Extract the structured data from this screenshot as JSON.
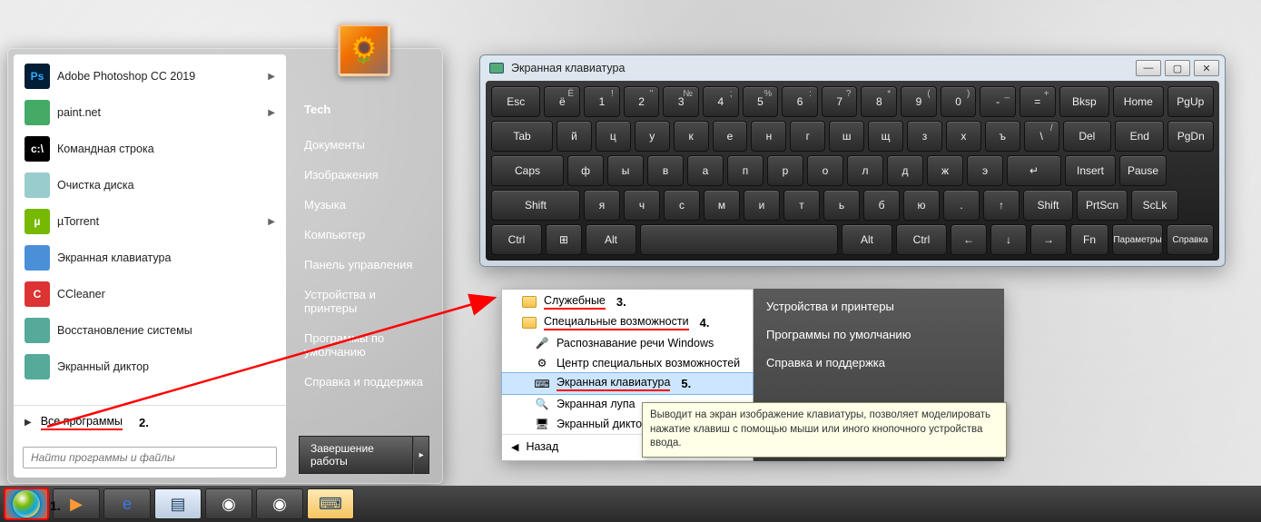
{
  "taskbar": {
    "step1": "1."
  },
  "start_menu": {
    "apps": [
      {
        "label": "Adobe Photoshop CC 2019",
        "icon_bg": "#001e36",
        "icon_txt": "Ps",
        "icon_color": "#31a8ff",
        "arrow": true
      },
      {
        "label": "paint.net",
        "icon_bg": "#4a6",
        "icon_txt": "",
        "arrow": true
      },
      {
        "label": "Командная строка",
        "icon_bg": "#000",
        "icon_txt": "c:\\",
        "arrow": false
      },
      {
        "label": "Очистка диска",
        "icon_bg": "#9cc",
        "icon_txt": "",
        "arrow": false
      },
      {
        "label": "µTorrent",
        "icon_bg": "#76b900",
        "icon_txt": "µ",
        "arrow": true
      },
      {
        "label": "Экранная клавиатура",
        "icon_bg": "#4a90d9",
        "icon_txt": "",
        "arrow": false
      },
      {
        "label": "CCleaner",
        "icon_bg": "#d33",
        "icon_txt": "C",
        "arrow": false
      },
      {
        "label": "Восстановление системы",
        "icon_bg": "#5a9",
        "icon_txt": "",
        "arrow": false
      },
      {
        "label": "Экранный диктор",
        "icon_bg": "#5a9",
        "icon_txt": "",
        "arrow": false
      }
    ],
    "all_programs": "Все программы",
    "step2": "2.",
    "search_placeholder": "Найти программы и файлы",
    "right_user": "Tech",
    "right_links": [
      "Документы",
      "Изображения",
      "Музыка",
      "Компьютер",
      "Панель управления",
      "Устройства и принтеры",
      "Программы по умолчанию",
      "Справка и поддержка"
    ],
    "shutdown": "Завершение работы"
  },
  "osk": {
    "title": "Экранная клавиатура",
    "row1": [
      {
        "l": "Esc",
        "w": "kw-1b"
      },
      {
        "l": "ё",
        "s": "Ё",
        "w": "kw-1"
      },
      {
        "l": "1",
        "s": "!",
        "w": "kw-1"
      },
      {
        "l": "2",
        "s": "\"",
        "w": "kw-1"
      },
      {
        "l": "3",
        "s": "№",
        "w": "kw-1"
      },
      {
        "l": "4",
        "s": ";",
        "w": "kw-1"
      },
      {
        "l": "5",
        "s": "%",
        "w": "kw-1"
      },
      {
        "l": "6",
        "s": ":",
        "w": "kw-1"
      },
      {
        "l": "7",
        "s": "?",
        "w": "kw-1"
      },
      {
        "l": "8",
        "s": "*",
        "w": "kw-1"
      },
      {
        "l": "9",
        "s": "(",
        "w": "kw-1"
      },
      {
        "l": "0",
        "s": ")",
        "w": "kw-1"
      },
      {
        "l": "-",
        "s": "_",
        "w": "kw-1"
      },
      {
        "l": "=",
        "s": "+",
        "w": "kw-1"
      },
      {
        "l": "Bksp",
        "w": "kw-bksp"
      },
      {
        "l": "Home",
        "w": "kw-hm"
      },
      {
        "l": "PgUp",
        "w": "kw-pg"
      }
    ],
    "row2": [
      {
        "l": "Tab",
        "w": "kw-tab"
      },
      {
        "l": "й",
        "w": "kw-1"
      },
      {
        "l": "ц",
        "w": "kw-1"
      },
      {
        "l": "у",
        "w": "kw-1"
      },
      {
        "l": "к",
        "w": "kw-1"
      },
      {
        "l": "е",
        "w": "kw-1"
      },
      {
        "l": "н",
        "w": "kw-1"
      },
      {
        "l": "г",
        "w": "kw-1"
      },
      {
        "l": "ш",
        "w": "kw-1"
      },
      {
        "l": "щ",
        "w": "kw-1"
      },
      {
        "l": "з",
        "w": "kw-1"
      },
      {
        "l": "х",
        "w": "kw-1"
      },
      {
        "l": "ъ",
        "w": "kw-1"
      },
      {
        "l": "\\",
        "s": "/",
        "w": "kw-1"
      },
      {
        "l": "Del",
        "w": "kw-1b"
      },
      {
        "l": "End",
        "w": "kw-hm"
      },
      {
        "l": "PgDn",
        "w": "kw-pg"
      }
    ],
    "row3": [
      {
        "l": "Caps",
        "w": "kw-caps"
      },
      {
        "l": "ф",
        "w": "kw-1"
      },
      {
        "l": "ы",
        "w": "kw-1"
      },
      {
        "l": "в",
        "w": "kw-1"
      },
      {
        "l": "а",
        "w": "kw-1"
      },
      {
        "l": "п",
        "w": "kw-1"
      },
      {
        "l": "р",
        "w": "kw-1"
      },
      {
        "l": "о",
        "w": "kw-1"
      },
      {
        "l": "л",
        "w": "kw-1"
      },
      {
        "l": "д",
        "w": "kw-1"
      },
      {
        "l": "ж",
        "w": "kw-1"
      },
      {
        "l": "э",
        "w": "kw-1"
      },
      {
        "l": "↵",
        "w": "kw-ent"
      },
      {
        "l": "Insert",
        "w": "kw-hm"
      },
      {
        "l": "Pause",
        "w": "kw-pg"
      }
    ],
    "row4": [
      {
        "l": "Shift",
        "w": "kw-sh"
      },
      {
        "l": "я",
        "w": "kw-1"
      },
      {
        "l": "ч",
        "w": "kw-1"
      },
      {
        "l": "с",
        "w": "kw-1"
      },
      {
        "l": "м",
        "w": "kw-1"
      },
      {
        "l": "и",
        "w": "kw-1"
      },
      {
        "l": "т",
        "w": "kw-1"
      },
      {
        "l": "ь",
        "w": "kw-1"
      },
      {
        "l": "б",
        "w": "kw-1"
      },
      {
        "l": "ю",
        "w": "kw-1"
      },
      {
        "l": ".",
        "w": "kw-1"
      },
      {
        "l": "↑",
        "w": "kw-1"
      },
      {
        "l": "Shift",
        "w": "kw-1b"
      },
      {
        "l": "PrtScn",
        "w": "kw-hm"
      },
      {
        "l": "ScLk",
        "w": "kw-pg"
      }
    ],
    "row5": [
      {
        "l": "Ctrl",
        "w": "kw-ctrl"
      },
      {
        "l": "⊞",
        "w": "kw-1"
      },
      {
        "l": "Alt",
        "w": "kw-ctrl"
      },
      {
        "l": "",
        "w": "kw-sp"
      },
      {
        "l": "Alt",
        "w": "kw-ctrl"
      },
      {
        "l": "Ctrl",
        "w": "kw-ctrl"
      },
      {
        "l": "←",
        "w": "kw-1"
      },
      {
        "l": "↓",
        "w": "kw-1"
      },
      {
        "l": "→",
        "w": "kw-1"
      },
      {
        "l": "Fn",
        "w": "kw-fn"
      },
      {
        "l": "Параметры",
        "w": "kw-hm"
      },
      {
        "l": "Справка",
        "w": "kw-pg"
      }
    ]
  },
  "submenu": {
    "step3": "3.",
    "step4": "4.",
    "step5": "5.",
    "items": [
      {
        "label": "Служебные",
        "type": "folder",
        "underline": true,
        "num": "3."
      },
      {
        "label": "Специальные возможности",
        "type": "folder",
        "underline": true,
        "num": "4."
      },
      {
        "label": "Распознавание речи Windows",
        "type": "app",
        "icon": "🎤"
      },
      {
        "label": "Центр специальных возможностей",
        "type": "app",
        "icon": "⚙"
      },
      {
        "label": "Экранная клавиатура",
        "type": "app",
        "icon": "⌨",
        "sel": true,
        "underline": true,
        "num": "5."
      },
      {
        "label": "Экранная лупа",
        "type": "app",
        "icon": "🔍"
      },
      {
        "label": "Экранный диктор",
        "type": "app",
        "icon": "🖥"
      }
    ],
    "back": "Назад",
    "right": [
      "Устройства и принтеры",
      "Программы по умолчанию",
      "Справка и поддержка"
    ]
  },
  "tooltip": "Выводит на экран изображение клавиатуры, позволяет моделировать нажатие клавиш с помощью мыши или иного кнопочного устройства ввода."
}
